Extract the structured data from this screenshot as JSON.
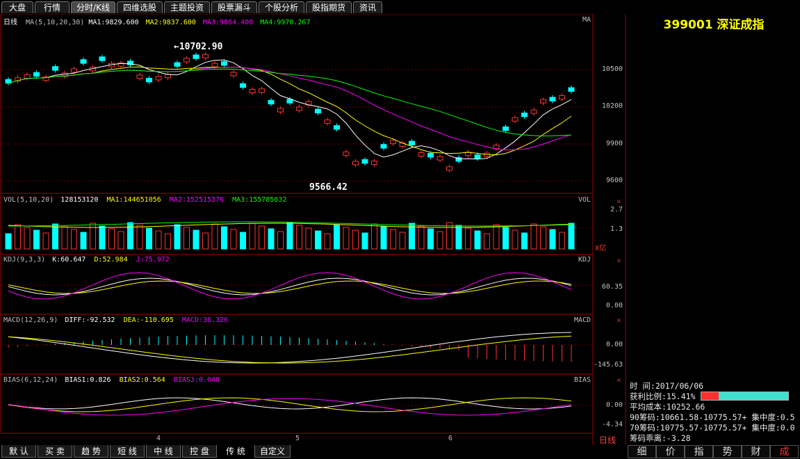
{
  "tabs": [
    "大盘",
    "行情",
    "分时/K线",
    "四维选股",
    "主题投资",
    "股票漏斗",
    "个股分析",
    "股指期货",
    "资讯"
  ],
  "active_tab": 2,
  "security": {
    "code_name": "399001 深证成指"
  },
  "kline": {
    "title": "日线",
    "ma_label": "MA(5,10,20,30)",
    "ma1": "MA1:9829.600",
    "ma2": "MA2:9837.600",
    "ma3": "MA3:9864.400",
    "ma4": "MA4:9970.267",
    "corner": "MA",
    "high_mark": "←10702.90",
    "low_mark": "9566.42",
    "price_ticks": [
      "10500",
      "10200",
      "9900",
      "9600"
    ]
  },
  "vol": {
    "label": "VOL(5,10,20)",
    "value": "128153120",
    "ma1": "MA1:144651056",
    "ma2": "MA2:152515376",
    "ma3": "MA3:155785632",
    "corner": "VOL",
    "ticks": [
      "2.7",
      "1.3"
    ],
    "unit": "X亿"
  },
  "kdj": {
    "label": "KDJ(9,3,3)",
    "k": "K:60.647",
    "d": "D:52.984",
    "j": "J:75.972",
    "corner": "KDJ",
    "ticks": [
      "60.35",
      "0.00"
    ]
  },
  "macd": {
    "label": "MACD(12,26,9)",
    "diff": "DIFF:-92.532",
    "dea": "DEA:-110.695",
    "macd": "MACD:36.326",
    "corner": "MACD",
    "ticks": [
      "0.00",
      "-145.63"
    ]
  },
  "bias": {
    "label": "BIAS(6,12,24)",
    "b1": "BIAS1:0.826",
    "b2": "BIAS2:0.564",
    "b3": "BIAS3:0.048",
    "corner": "BIAS",
    "ticks": [
      "0.00",
      "-4.34"
    ]
  },
  "months": [
    "4",
    "5",
    "6"
  ],
  "period": "日线",
  "chip": {
    "time_label": "时      间:2017/06/06",
    "profit_label": "获利比例:15.41%",
    "profit_ratio": 0.1541,
    "avg_cost": "平均成本:10252.66",
    "c90": "90筹码:10661.58-10775.57+ 集中度:0.5",
    "c70": "70筹码:10775.57-10775.57+ 集中度:0.0",
    "deviation": "筹码乖离:-3.28"
  },
  "bottom_tabs": [
    "默 认",
    "买 卖",
    "趋 势",
    "短 线",
    "中 线",
    "控 盘",
    "传 统",
    "自定义"
  ],
  "bottom_active": 6,
  "right_tabs": [
    "细",
    "价",
    "指",
    "势",
    "财",
    "成"
  ],
  "colors": {
    "up": "#ff3333",
    "down": "#00ffff",
    "ma1": "#ffffff",
    "ma2": "#ffff00",
    "ma3": "#ff00ff",
    "ma4": "#00ff00",
    "grid": "#8b0000"
  }
}
